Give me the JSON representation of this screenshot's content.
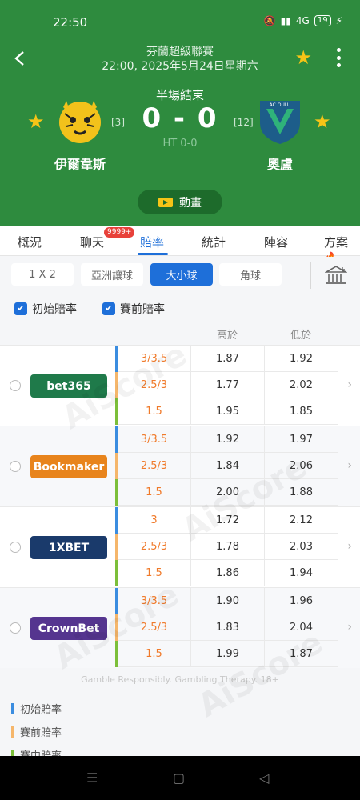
{
  "status_bar": {
    "time": "22:50",
    "battery": "19",
    "network": "4G"
  },
  "header": {
    "league": "芬蘭超級聯賽",
    "datetime": "22:00, 2025年5月24日星期六",
    "match_status": "半場結束",
    "score": "0 - 0",
    "half_time": "HT 0-0",
    "home": {
      "name": "伊爾韋斯",
      "rank": "[3]"
    },
    "away": {
      "name": "奧盧",
      "rank": "[12]",
      "logo_text": "AC OULU"
    },
    "animation_label": "動畫"
  },
  "tabs": [
    {
      "label": "概況"
    },
    {
      "label": "聊天",
      "badge": "9999+"
    },
    {
      "label": "賠率",
      "active": true
    },
    {
      "label": "統計"
    },
    {
      "label": "陣容"
    },
    {
      "label": "方案"
    }
  ],
  "odds_types": [
    {
      "label": "1 X 2"
    },
    {
      "label": "亞洲讓球"
    },
    {
      "label": "大小球",
      "active": true
    },
    {
      "label": "角球"
    }
  ],
  "filters": {
    "initial": "初始賠率",
    "prematch": "賽前賠率"
  },
  "table": {
    "col_over": "高於",
    "col_under": "低於",
    "bookmakers": [
      {
        "name": "bet365",
        "color": "#1f7a4a",
        "rows": [
          {
            "type": "initial",
            "line": "3/3.5",
            "over": "1.87",
            "under": "1.92"
          },
          {
            "type": "prematch",
            "line": "2.5/3",
            "over": "1.77",
            "under": "2.02"
          },
          {
            "type": "live",
            "line": "1.5",
            "over": "1.95",
            "under": "1.85"
          }
        ]
      },
      {
        "name": "Bookmaker",
        "color": "#e8841c",
        "rows": [
          {
            "type": "initial",
            "line": "3/3.5",
            "over": "1.92",
            "under": "1.97"
          },
          {
            "type": "prematch",
            "line": "2.5/3",
            "over": "1.84",
            "under": "2.06"
          },
          {
            "type": "live",
            "line": "1.5",
            "over": "2.00",
            "under": "1.88"
          }
        ]
      },
      {
        "name": "1XBET",
        "color": "#1a3a6b",
        "rows": [
          {
            "type": "initial",
            "line": "3",
            "over": "1.72",
            "under": "2.12"
          },
          {
            "type": "prematch",
            "line": "2.5/3",
            "over": "1.78",
            "under": "2.03"
          },
          {
            "type": "live",
            "line": "1.5",
            "over": "1.86",
            "under": "1.94"
          }
        ]
      },
      {
        "name": "CrownBet",
        "color": "#55358f",
        "rows": [
          {
            "type": "initial",
            "line": "3/3.5",
            "over": "1.90",
            "under": "1.96"
          },
          {
            "type": "prematch",
            "line": "2.5/3",
            "over": "1.83",
            "under": "2.04"
          },
          {
            "type": "live",
            "line": "1.5",
            "over": "1.99",
            "under": "1.87"
          }
        ]
      }
    ]
  },
  "disclaimer": "Gamble Responsibly. Gambling Therapy. 18+",
  "legend": [
    "初始賠率",
    "賽前賠率",
    "賽中賠率"
  ],
  "colors": {
    "initial": "#3b8de0",
    "prematch": "#f5b66b",
    "live": "#7cbf3a",
    "accent": "#1e6fd9",
    "header": "#2e8b3e"
  },
  "watermark": "AiScore"
}
